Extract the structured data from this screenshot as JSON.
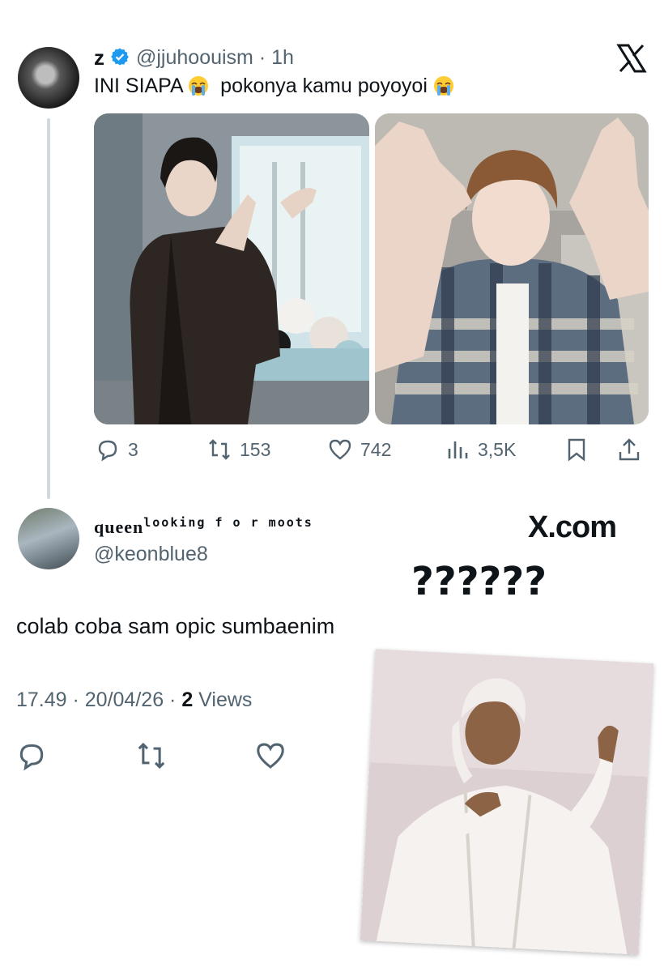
{
  "tweet": {
    "display_name": "z",
    "handle": "@jjuhoouism",
    "separator": " · ",
    "time": "1h",
    "text_part1": "INI SIAPA",
    "text_part2": "pokonya kamu poyoyoi",
    "actions": {
      "replies": "3",
      "retweets": "153",
      "likes": "742",
      "views": "3,5K"
    }
  },
  "reply": {
    "name_main": "queen",
    "name_super": "looking f o r moots",
    "handle": "@keonblue8",
    "text": "colab coba sam opic sumbaenim",
    "timestamp": "17.49 · 20/04/26 · ",
    "views_count": "2",
    "views_label": " Views"
  },
  "watermark": "X.com",
  "question_marks": "??????",
  "icons": [
    "x-logo-icon",
    "verified-badge-icon",
    "crying-face-icon",
    "reply-icon",
    "retweet-icon",
    "like-icon",
    "views-icon",
    "bookmark-icon",
    "share-icon"
  ],
  "colors": {
    "text": "#0f1419",
    "secondary": "#536471",
    "verified": "#1d9bf0"
  }
}
